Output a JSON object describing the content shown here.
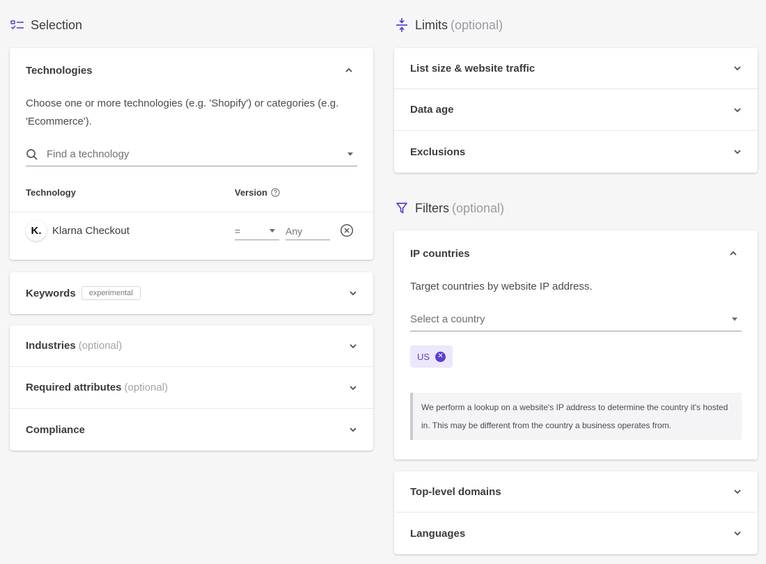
{
  "selection": {
    "title": "Selection",
    "technologies": {
      "header": "Technologies",
      "description": "Choose one or more technologies (e.g. 'Shopify') or categories (e.g. 'Ecommerce').",
      "search_placeholder": "Find a technology",
      "col_technology": "Technology",
      "col_version": "Version",
      "rows": [
        {
          "logo": "K.",
          "name": "Klarna Checkout",
          "operator": "=",
          "version_placeholder": "Any"
        }
      ]
    },
    "keywords": {
      "label": "Keywords",
      "badge": "experimental"
    },
    "industries": {
      "label": "Industries",
      "opt": "(optional)"
    },
    "required_attributes": {
      "label": "Required attributes",
      "opt": "(optional)"
    },
    "compliance": {
      "label": "Compliance"
    }
  },
  "limits": {
    "title": "Limits",
    "opt": "(optional)",
    "items": [
      "List size & website traffic",
      "Data age",
      "Exclusions"
    ]
  },
  "filters": {
    "title": "Filters",
    "opt": "(optional)",
    "ip_countries": {
      "header": "IP countries",
      "description": "Target countries by website IP address.",
      "select_placeholder": "Select a country",
      "chips": [
        "US"
      ],
      "note": "We perform a lookup on a website's IP address to determine the country it's hosted in. This may be different from the country a business operates from."
    },
    "more": [
      "Top-level domains",
      "Languages"
    ]
  },
  "colors": {
    "accent": "#5b3fd0",
    "chip_bg": "#ece7fb",
    "background": "#f6f6f7"
  }
}
